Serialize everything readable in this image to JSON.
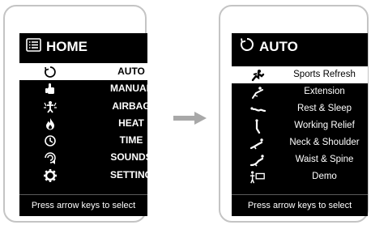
{
  "home_screen": {
    "title": "HOME",
    "title_icon": "list-icon",
    "items": [
      {
        "label": "AUTO",
        "icon": "auto-cycle-icon",
        "selected": true
      },
      {
        "label": "MANUAL",
        "icon": "hand-icon",
        "selected": false
      },
      {
        "label": "AIRBAG",
        "icon": "airbag-person-icon",
        "selected": false
      },
      {
        "label": "HEAT",
        "icon": "flame-icon",
        "selected": false
      },
      {
        "label": "TIME",
        "icon": "clock-icon",
        "selected": false
      },
      {
        "label": "SOUNDS",
        "icon": "sound-icon",
        "selected": false
      },
      {
        "label": "SETTING",
        "icon": "gear-icon",
        "selected": false
      }
    ],
    "hint": "Press arrow keys to select"
  },
  "auto_screen": {
    "title": "AUTO",
    "title_icon": "auto-cycle-icon",
    "items": [
      {
        "label": "Sports Refresh",
        "icon": "sports-refresh-icon",
        "selected": true
      },
      {
        "label": "Extension",
        "icon": "extension-icon",
        "selected": false
      },
      {
        "label": "Rest & Sleep",
        "icon": "rest-sleep-icon",
        "selected": false
      },
      {
        "label": "Working Relief",
        "icon": "working-relief-icon",
        "selected": false
      },
      {
        "label": "Neck & Shoulder",
        "icon": "neck-shoulder-icon",
        "selected": false
      },
      {
        "label": "Waist & Spine",
        "icon": "waist-spine-icon",
        "selected": false
      },
      {
        "label": "Demo",
        "icon": "demo-icon",
        "selected": false
      }
    ],
    "hint": "Press arrow keys to select"
  },
  "transition_arrow_icon": "arrow-right-icon",
  "colors": {
    "screen_bg": "#000000",
    "text": "#ffffff",
    "selected_bg": "#ffffff",
    "selected_text": "#000000",
    "device_border": "#c4c4c4",
    "arrow": "#a8a8a8"
  }
}
